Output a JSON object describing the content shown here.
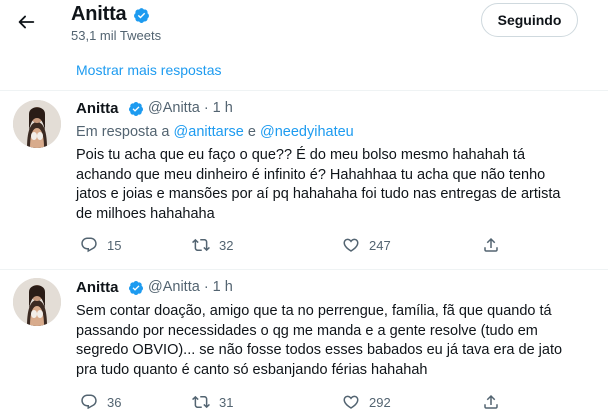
{
  "header": {
    "name": "Anitta",
    "tweet_count": "53,1 mil Tweets",
    "follow_label": "Seguindo"
  },
  "thread": {
    "more_replies": "Mostrar mais respostas"
  },
  "tweets": [
    {
      "name": "Anitta",
      "handle_time": "@Anitta · 1 h",
      "reply_prefix": "Em resposta a",
      "mention1": "@anittarse",
      "conj": "e",
      "mention2": "@needyihateu",
      "text": "Pois tu acha que eu faço o que?? É do meu bolso mesmo hahahah tá achando que meu dinheiro é infinito é? Hahahhaa tu acha que não tenho jatos e joias e mansões por aí pq hahahaha foi tudo nas entregas de artista de milhoes hahahaha",
      "replies": "15",
      "retweets": "32",
      "likes": "247"
    },
    {
      "name": "Anitta",
      "handle_time": "@Anitta · 1 h",
      "text": "Sem contar doação, amigo que ta no perrengue, família, fã que quando tá passando por necessidades o qg me manda e a gente resolve (tudo em segredo OBVIO)... se não fosse todos esses babados eu já tava era de jato pra tudo quanto é canto só esbanjando férias hahahah",
      "replies": "36",
      "retweets": "31",
      "likes": "292"
    }
  ],
  "icons": {
    "back": "arrow-left-icon",
    "verified": "verified-badge-icon",
    "reply": "reply-icon",
    "retweet": "retweet-icon",
    "like": "heart-icon",
    "share": "share-icon"
  },
  "colors": {
    "accent": "#1d9bf0",
    "text": "#0f1419",
    "secondary": "#536471"
  }
}
